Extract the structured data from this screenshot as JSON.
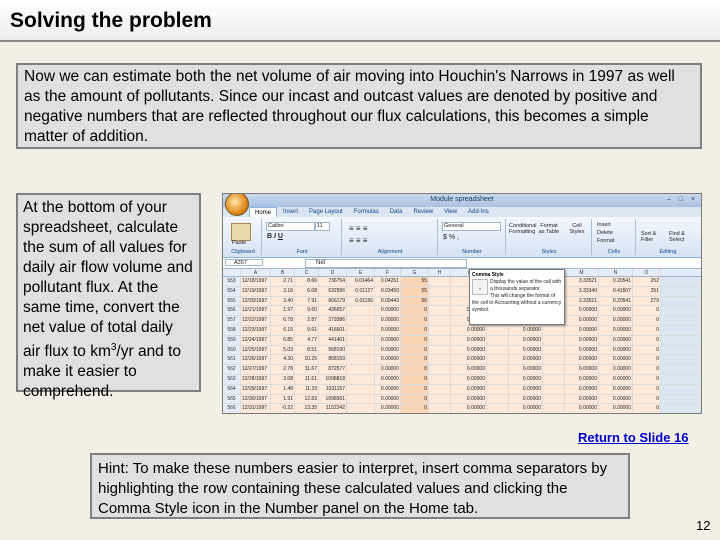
{
  "title": "Solving the problem",
  "intro": "Now we can estimate both the net volume of air moving into Houchin's Narrows in 1997 as well as the amount of pollutants.  Since our incast and outcast values are denoted by positive and negative numbers that are reflected throughout our flux calculations, this becomes a simple matter of addition.",
  "side_text_before": "At the bottom of your spreadsheet, calculate the sum of all values for daily air flow volume and pollutant flux.  At the same time, convert the net value of total daily air flux to km",
  "side_text_sup": "3",
  "side_text_after": "/yr and to make it easier to comprehend.",
  "link": "Return to Slide 16",
  "hint": "Hint: To make these numbers easier to interpret, insert comma separators by highlighting the row containing these calculated values and clicking the Comma Style icon in the Number panel on the Home tab.",
  "page_number": "12",
  "spreadsheet": {
    "window_title": "Module spreadsheet",
    "tabs": [
      "Home",
      "Insert",
      "Page Layout",
      "Formulas",
      "Data",
      "Review",
      "View",
      "Add-Ins"
    ],
    "font_name": "Calibri",
    "font_size": "11",
    "number_format": "General",
    "groups": [
      "Clipboard",
      "Font",
      "Alignment",
      "Number",
      "Styles",
      "Cells",
      "Editing"
    ],
    "buttons": {
      "paste": "Paste",
      "conditional": "Conditional Formatting",
      "format_table": "Format as Table",
      "cell_styles": "Cell Styles",
      "insert": "Insert",
      "delete": "Delete",
      "format": "Format",
      "sort": "Sort & Filter",
      "find": "Find & Select"
    },
    "name_box": "A357",
    "formula": "Net",
    "tooltip_title": "Comma Style",
    "tooltip_line1": "Display the value of the cell with a thousands separator.",
    "tooltip_line2": "This will change the format of the cell to Accounting without a currency symbol.",
    "columns": [
      "A",
      "B",
      "C",
      "D",
      "E",
      "F",
      "G",
      "H",
      "I",
      "J",
      "K",
      "L",
      "M",
      "N",
      "O"
    ],
    "rows": [
      {
        "n": "553",
        "cells": [
          "12/18/1997",
          "2.71",
          "8.66",
          "736754",
          "0.01464",
          "0.04261",
          "55",
          "",
          "",
          "",
          "",
          "",
          "3.33521",
          "0.20541",
          "252"
        ]
      },
      {
        "n": "554",
        "cells": [
          "12/19/1997",
          "3.16",
          "6.08",
          "632556",
          "0.01127",
          "0.03450",
          "55",
          "",
          "",
          "",
          "",
          "",
          "3.33340",
          "0.41507",
          "251"
        ]
      },
      {
        "n": "555",
        "cells": [
          "12/20/1997",
          "3.40",
          "7.91",
          "666179",
          "0.01156",
          "0.09443",
          "56",
          "",
          "",
          "",
          "",
          "",
          "3.33521",
          "0.20541",
          "279"
        ]
      },
      {
        "n": "556",
        "cells": [
          "12/21/1997",
          "1.97",
          "9.60",
          "436657",
          "",
          "0.00000",
          "0",
          "",
          "0.00000",
          "",
          "0.00000",
          "",
          "0.00000",
          "0.00000",
          "0"
        ]
      },
      {
        "n": "557",
        "cells": [
          "12/22/1997",
          "6.78",
          "2.87",
          "279386",
          "",
          "0.00000",
          "0",
          "",
          "0.00000",
          "",
          "0.00000",
          "",
          "0.00000",
          "0.00000",
          "0"
        ]
      },
      {
        "n": "558",
        "cells": [
          "12/23/1997",
          "6.15",
          "9.61",
          "416601",
          "",
          "0.00000",
          "0",
          "",
          "0.00000",
          "",
          "0.00000",
          "",
          "0.00000",
          "0.00000",
          "0"
        ]
      },
      {
        "n": "559",
        "cells": [
          "12/24/1997",
          "6.85",
          "4.77",
          "441401",
          "",
          "0.00000",
          "0",
          "",
          "0.00000",
          "",
          "0.00000",
          "",
          "0.00000",
          "0.00000",
          "0"
        ]
      },
      {
        "n": "560",
        "cells": [
          "12/25/1997",
          "5.03",
          "8.51",
          "568190",
          "",
          "0.00000",
          "0",
          "",
          "0.00000",
          "",
          "0.00000",
          "",
          "0.00000",
          "0.00000",
          "0"
        ]
      },
      {
        "n": "561",
        "cells": [
          "12/26/1997",
          "4.30",
          "10.25",
          "868159",
          "",
          "0.00000",
          "0",
          "",
          "0.00000",
          "",
          "0.00000",
          "",
          "0.00000",
          "0.00000",
          "0"
        ]
      },
      {
        "n": "562",
        "cells": [
          "12/27/1997",
          "2.78",
          "11.67",
          "872577",
          "",
          "0.00000",
          "0",
          "",
          "0.00000",
          "",
          "0.00000",
          "",
          "0.00000",
          "0.00000",
          "0"
        ]
      },
      {
        "n": "563",
        "cells": [
          "12/28/1997",
          "3.08",
          "11.61",
          "1098818",
          "",
          "0.00000",
          "0",
          "",
          "0.00000",
          "",
          "0.00000",
          "",
          "0.00000",
          "0.00000",
          "0"
        ]
      },
      {
        "n": "564",
        "cells": [
          "12/29/1997",
          "1.48",
          "11.33",
          "1031157",
          "",
          "0.00000",
          "0",
          "",
          "0.00000",
          "",
          "0.00000",
          "",
          "0.00000",
          "0.00000",
          "0"
        ]
      },
      {
        "n": "565",
        "cells": [
          "12/30/1997",
          "1.91",
          "12.83",
          "1098561",
          "",
          "0.00000",
          "0",
          "",
          "0.00000",
          "",
          "0.00000",
          "",
          "0.00000",
          "0.00000",
          "0"
        ]
      },
      {
        "n": "566",
        "cells": [
          "12/31/1997",
          "-0.22",
          "13.35",
          "1152242",
          "",
          "0.00000",
          "0",
          "",
          "0.00000",
          "",
          "0.00000",
          "",
          "0.00000",
          "0.00000",
          "0"
        ]
      },
      {
        "n": "567",
        "selected": true,
        "cells": [
          "Net",
          "",
          "",
          "40,880",
          "",
          "",
          "363",
          "",
          "",
          "",
          "1,519",
          "",
          "",
          "",
          "36,397"
        ]
      }
    ]
  }
}
